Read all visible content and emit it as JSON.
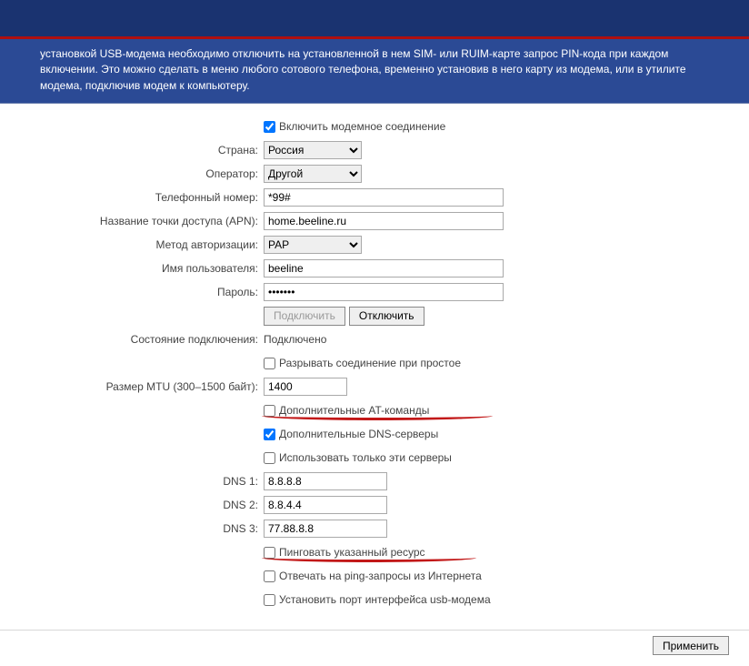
{
  "banner": {
    "text": "установкой USB-модема необходимо отключить на установленной в нем SIM- или RUIM-карте запрос PIN-кода при каждом включении. Это можно сделать в меню любого сотового телефона, временно установив в него карту из модема, или в утилите модема, подключив модем к компьютеру."
  },
  "fields": {
    "enable_modem": {
      "label": "Включить модемное соединение",
      "checked": true
    },
    "country": {
      "label": "Страна:",
      "value": "Россия"
    },
    "operator": {
      "label": "Оператор:",
      "value": "Другой"
    },
    "phone": {
      "label": "Телефонный номер:",
      "value": "*99#"
    },
    "apn": {
      "label": "Название точки доступа (APN):",
      "value": "home.beeline.ru"
    },
    "auth": {
      "label": "Метод авторизации:",
      "value": "PAP"
    },
    "username": {
      "label": "Имя пользователя:",
      "value": "beeline"
    },
    "password": {
      "label": "Пароль:",
      "value": "•••••••"
    },
    "btn_connect": "Подключить",
    "btn_disconnect": "Отключить",
    "conn_state": {
      "label": "Состояние подключения:",
      "value": "Подключено"
    },
    "idle_disconnect": {
      "label": "Разрывать соединение при простое",
      "checked": false
    },
    "mtu": {
      "label": "Размер MTU (300–1500 байт):",
      "value": "1400"
    },
    "at_commands": {
      "label": "Дополнительные AT-команды",
      "checked": false
    },
    "extra_dns": {
      "label": "Дополнительные DNS-серверы",
      "checked": true
    },
    "only_these_dns": {
      "label": "Использовать только эти серверы",
      "checked": false
    },
    "dns1": {
      "label": "DNS 1:",
      "value": "8.8.8.8"
    },
    "dns2": {
      "label": "DNS 2:",
      "value": "8.8.4.4"
    },
    "dns3": {
      "label": "DNS 3:",
      "value": "77.88.8.8"
    },
    "ping_resource": {
      "label": "Пинговать указанный ресурс",
      "checked": false
    },
    "answer_ping": {
      "label": "Отвечать на ping-запросы из Интернета",
      "checked": false
    },
    "set_usb_port": {
      "label": "Установить порт интерфейса usb-модема",
      "checked": false
    }
  },
  "buttons": {
    "apply": "Применить"
  }
}
